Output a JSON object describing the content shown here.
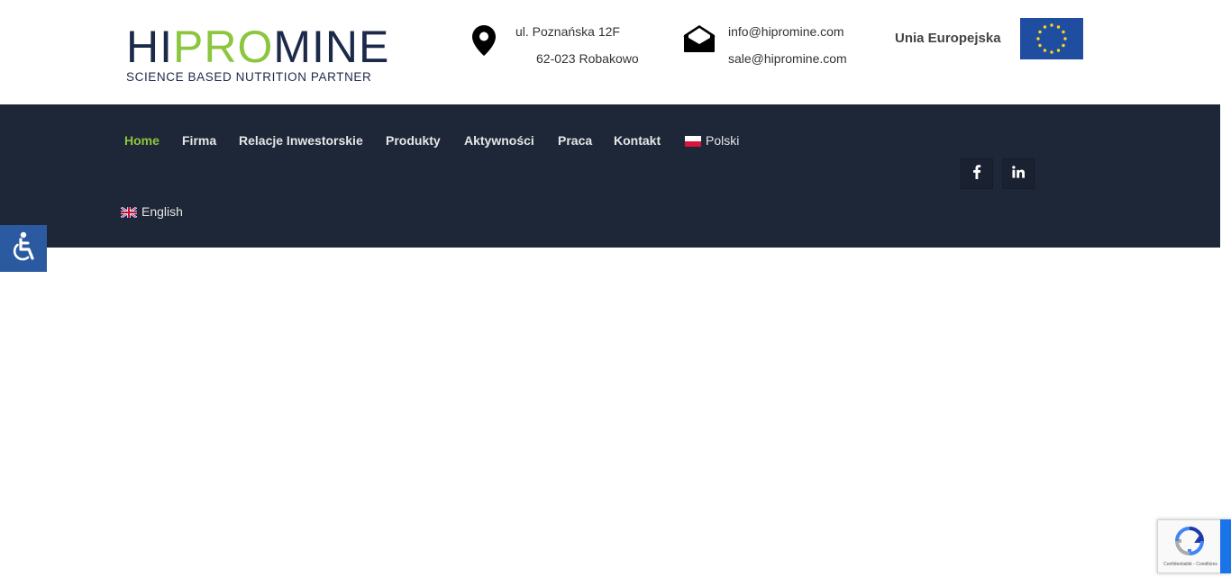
{
  "brand": {
    "logo_text_a": "HI",
    "logo_text_b": "PRO",
    "logo_text_c": "MINE",
    "tagline": "SCIENCE BASED NUTRITION PARTNER",
    "accent_color": "#8cc63f",
    "dark_color": "#1c2a4a"
  },
  "contact": {
    "address_icon": "map-pin-icon",
    "address_line1": "ul. Poznańska 12F",
    "address_line2": "62-023 Robakowo",
    "email_icon": "envelope-open-icon",
    "email1": "info@hipromine.com",
    "email2": "sale@hipromine.com"
  },
  "eu": {
    "label": "Unia Europejska",
    "flag_color": "#1f4ea1",
    "star_color": "#ffd617"
  },
  "nav": {
    "background": "#1e2738",
    "items": [
      {
        "label": "Home",
        "active": true
      },
      {
        "label": "Firma"
      },
      {
        "label": "Relacje Inwestorskie"
      },
      {
        "label": "Produkty"
      },
      {
        "label": "Aktywności"
      },
      {
        "label": "Praca"
      },
      {
        "label": "Kontakt"
      }
    ],
    "lang_pl": "Polski",
    "lang_en": "English",
    "social": [
      "facebook-icon",
      "linkedin-icon"
    ]
  },
  "recaptcha": {
    "links": "Confidentialité - Conditions"
  }
}
